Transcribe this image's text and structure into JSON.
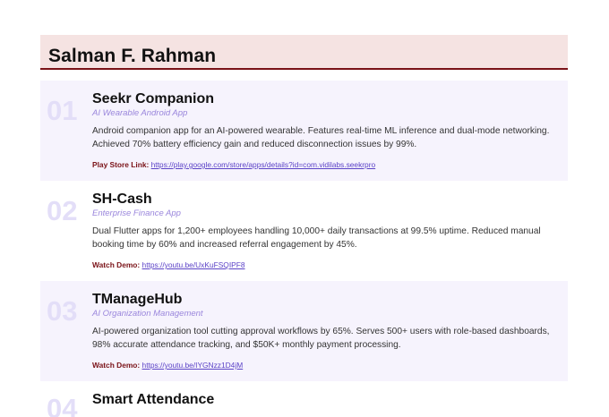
{
  "header": {
    "name": "Salman F. Rahman"
  },
  "projects": [
    {
      "number": "01",
      "title": "Seekr Companion",
      "subtitle": "AI Wearable Android App",
      "description": "Android companion app for an AI-powered wearable. Features real-time ML inference and dual-mode networking. Achieved 70% battery efficiency gain and reduced disconnection issues by 99%.",
      "link_label": "Play Store Link:",
      "link_url": "https://play.google.com/store/apps/details?id=com.vidilabs.seekrpro"
    },
    {
      "number": "02",
      "title": "SH-Cash",
      "subtitle": "Enterprise Finance App",
      "description": "Dual Flutter apps for 1,200+ employees handling 10,000+ daily transactions at 99.5% uptime. Reduced manual booking time by 60% and increased referral engagement by 45%.",
      "link_label": "Watch Demo:",
      "link_url": "https://youtu.be/UxKuFSQIPF8"
    },
    {
      "number": "03",
      "title": "TManageHub",
      "subtitle": "AI Organization Management",
      "description": "AI-powered organization tool cutting approval workflows by 65%. Serves 500+ users with role-based dashboards, 98% accurate attendance tracking, and $50K+ monthly payment processing.",
      "link_label": "Watch Demo:",
      "link_url": "https://youtu.be/IYGNzz1D4jM"
    },
    {
      "number": "04",
      "title": "Smart Attendance"
    }
  ]
}
